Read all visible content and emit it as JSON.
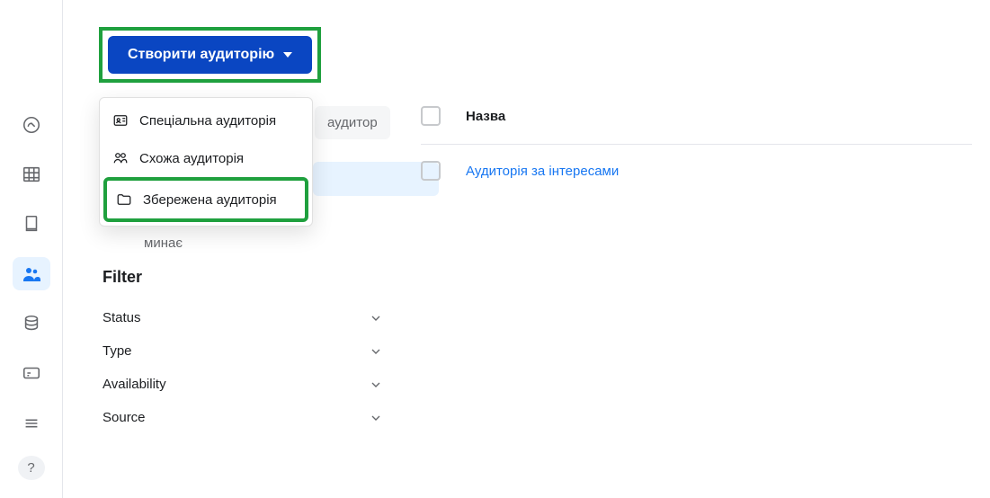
{
  "create_button": {
    "label": "Створити аудиторію"
  },
  "dropdown": {
    "custom": "Спеціальна аудиторія",
    "lookalike": "Схожа аудиторія",
    "saved": "Збережена аудиторія"
  },
  "behind_input_placeholder": "аудитор",
  "mynae_text": "минає",
  "filter": {
    "title": "Filter",
    "status": "Status",
    "type": "Type",
    "availability": "Availability",
    "source": "Source"
  },
  "table": {
    "header_name": "Назва",
    "row1_link": "Аудиторія за інтересами"
  }
}
